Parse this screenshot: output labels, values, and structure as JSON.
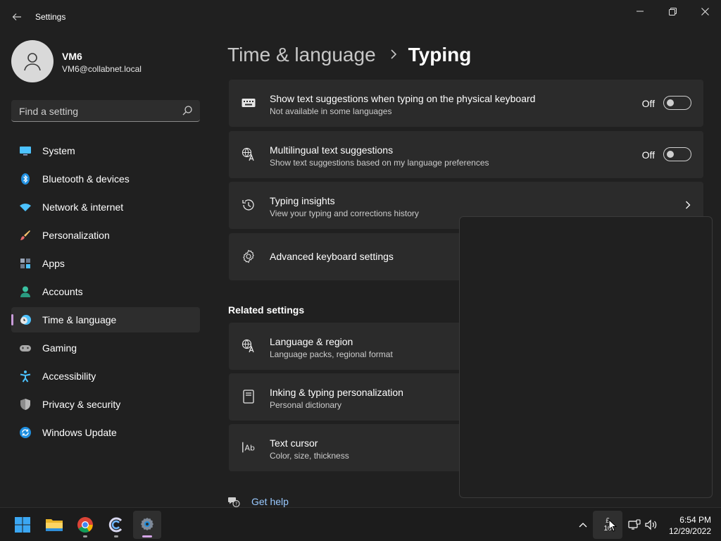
{
  "app": {
    "title": "Settings"
  },
  "profile": {
    "name": "VM6",
    "email": "VM6@collabnet.local"
  },
  "search": {
    "placeholder": "Find a setting"
  },
  "sidebar": {
    "items": [
      {
        "label": "System",
        "icon": "monitor-icon"
      },
      {
        "label": "Bluetooth & devices",
        "icon": "bluetooth-icon"
      },
      {
        "label": "Network & internet",
        "icon": "wifi-icon"
      },
      {
        "label": "Personalization",
        "icon": "brush-icon"
      },
      {
        "label": "Apps",
        "icon": "apps-icon"
      },
      {
        "label": "Accounts",
        "icon": "person-icon"
      },
      {
        "label": "Time & language",
        "icon": "clock-globe-icon",
        "selected": true
      },
      {
        "label": "Gaming",
        "icon": "gamepad-icon"
      },
      {
        "label": "Accessibility",
        "icon": "accessibility-icon"
      },
      {
        "label": "Privacy & security",
        "icon": "shield-icon"
      },
      {
        "label": "Windows Update",
        "icon": "update-icon"
      }
    ]
  },
  "breadcrumb": {
    "parent": "Time & language",
    "current": "Typing"
  },
  "settings": {
    "text_suggestions": {
      "title": "Show text suggestions when typing on the physical keyboard",
      "subtitle": "Not available in some languages",
      "state": "Off"
    },
    "multilingual": {
      "title": "Multilingual text suggestions",
      "subtitle": "Show text suggestions based on my language preferences",
      "state": "Off"
    },
    "insights": {
      "title": "Typing insights",
      "subtitle": "View your typing and corrections history"
    },
    "advanced": {
      "title": "Advanced keyboard settings"
    }
  },
  "related": {
    "heading": "Related settings",
    "items": [
      {
        "title": "Language & region",
        "subtitle": "Language packs, regional format"
      },
      {
        "title": "Inking & typing personalization",
        "subtitle": "Personal dictionary"
      },
      {
        "title": "Text cursor",
        "subtitle": "Color, size, thickness"
      }
    ]
  },
  "help": {
    "label": "Get help"
  },
  "taskbar": {
    "apps": [
      "start-icon",
      "file-explorer-icon",
      "chrome-icon",
      "ccleaner-icon",
      "settings-icon"
    ],
    "clock": {
      "time": "6:54 PM",
      "date": "12/29/2022"
    },
    "tray_partial": {
      "top": "£",
      "bottom": "10"
    }
  },
  "colors": {
    "accent": "#c89bd9",
    "link": "#99c9ff",
    "card": "#2b2b2b",
    "background": "#202020"
  }
}
